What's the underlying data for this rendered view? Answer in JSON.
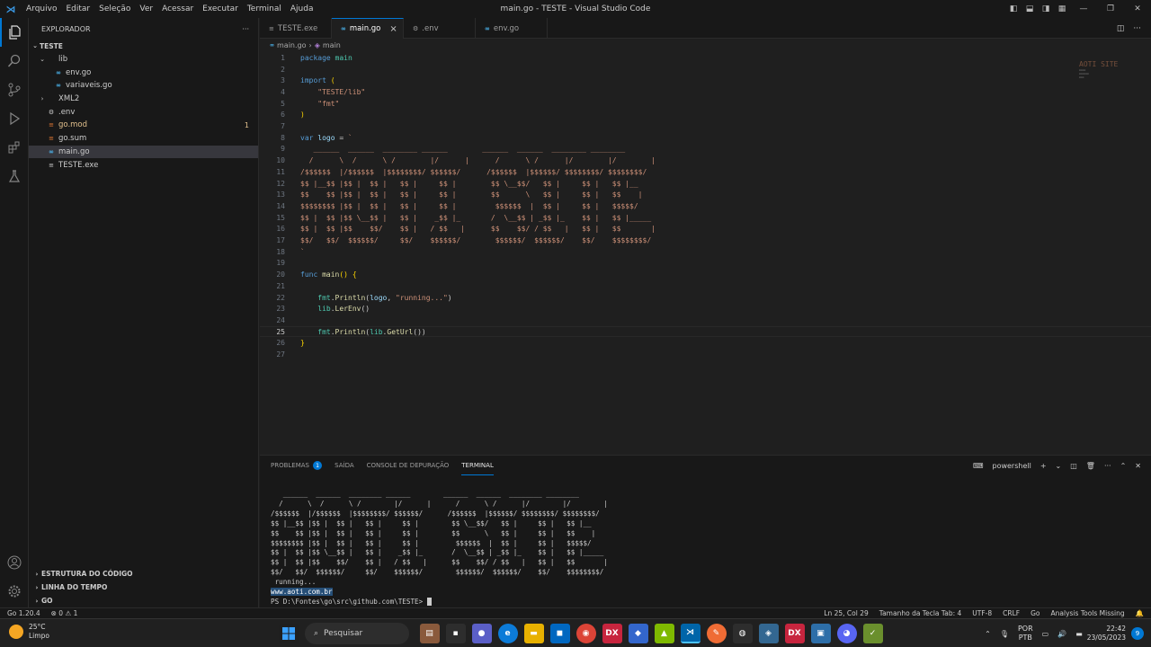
{
  "titlebar": {
    "menu": [
      "Arquivo",
      "Editar",
      "Seleção",
      "Ver",
      "Acessar",
      "Executar",
      "Terminal",
      "Ajuda"
    ],
    "title": "main.go - TESTE - Visual Studio Code"
  },
  "sidebar": {
    "header": "EXPLORADOR",
    "more": "···",
    "root": "TESTE",
    "items": [
      {
        "label": "lib",
        "indent": 1,
        "type": "folder"
      },
      {
        "label": "env.go",
        "indent": 2,
        "type": "go"
      },
      {
        "label": "variaveis.go",
        "indent": 2,
        "type": "go"
      },
      {
        "label": "XML2",
        "indent": 1,
        "type": "folder-closed"
      },
      {
        "label": ".env",
        "indent": 1,
        "type": "gear"
      },
      {
        "label": "go.mod",
        "indent": 1,
        "type": "mod",
        "badge": "1"
      },
      {
        "label": "go.sum",
        "indent": 1,
        "type": "sum"
      },
      {
        "label": "main.go",
        "indent": 1,
        "type": "go",
        "selected": true
      },
      {
        "label": "TESTE.exe",
        "indent": 1,
        "type": "exe"
      }
    ],
    "sections": [
      "ESTRUTURA DO CÓDIGO",
      "LINHA DO TEMPO",
      "GO"
    ]
  },
  "tabs": [
    {
      "label": "TESTE.exe",
      "icon": "≡"
    },
    {
      "label": "main.go",
      "icon": "∞",
      "active": true
    },
    {
      "label": ".env",
      "icon": "⚙"
    },
    {
      "label": "env.go",
      "icon": "∞"
    }
  ],
  "breadcrumb": [
    "main.go",
    "›",
    "main"
  ],
  "code": {
    "current_line": 25,
    "minimap_text": "AOTI SITE"
  },
  "panel": {
    "tabs": [
      {
        "label": "PROBLEMAS",
        "count": "1"
      },
      {
        "label": "SAÍDA"
      },
      {
        "label": "CONSOLE DE DEPURAÇÃO"
      },
      {
        "label": "TERMINAL",
        "active": true
      }
    ],
    "shell": "powershell",
    "terminal": {
      "running": " running...",
      "url": "www.aoti.com.br",
      "prompt": "PS D:\\Fontes\\go\\src\\github.com\\TESTE> "
    }
  },
  "statusbar": {
    "go_version": "Go 1.20.4",
    "problems": "⊗ 0 ⚠ 1",
    "position": "Ln 25, Col 29",
    "tab_size": "Tamanho da Tecla Tab: 4",
    "encoding": "UTF-8",
    "eol": "CRLF",
    "language": "Go",
    "analysis": "Analysis Tools Missing"
  },
  "taskbar": {
    "temp": "25°C",
    "weather": "Limpo",
    "search": "Pesquisar",
    "lang1": "POR",
    "lang2": "PTB",
    "time": "22:42",
    "date": "23/05/2023",
    "notifications": "9"
  }
}
